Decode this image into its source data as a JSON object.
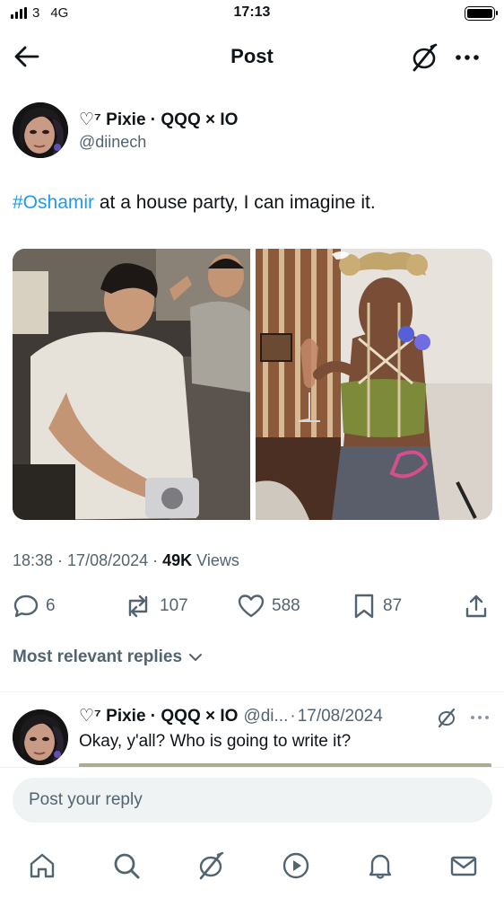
{
  "status_bar": {
    "carrier": "3",
    "network": "4G",
    "time": "17:13",
    "battery_level": 1.0
  },
  "header": {
    "title": "Post",
    "back_icon": "arrow-left-icon",
    "brand_icon": "circle-slash-logo-icon",
    "more_icon": "more-horizontal-icon"
  },
  "post": {
    "author": {
      "display_name": "♡⁷ Pixie · QQQ × IO",
      "handle": "@diinech"
    },
    "text": {
      "hashtag": "#Oshamir",
      "body": " at a house party, I can imagine it."
    },
    "meta": {
      "time": "18:38",
      "sep1": "·",
      "date": "17/08/2024",
      "sep2": "·",
      "views_count": "49K",
      "views_label": "Views"
    },
    "actions": {
      "replies": "6",
      "reposts": "107",
      "likes": "588",
      "bookmarks": "87"
    }
  },
  "replies_filter": {
    "label": "Most relevant replies"
  },
  "reply": {
    "display_name": "♡⁷ Pixie · QQQ × IO",
    "handle": "@di...",
    "sep": "·",
    "date": "17/08/2024",
    "text": "Okay, y'all? Who is going to write it?"
  },
  "composer": {
    "placeholder": "Post your reply"
  },
  "tabbar": {
    "items": [
      "home-icon",
      "search-icon",
      "circle-slash-logo-icon",
      "play-icon",
      "bell-icon",
      "mail-icon"
    ]
  },
  "colors": {
    "accent": "#1d9bf0",
    "secondary_text": "#536471",
    "primary_text": "#0f1419",
    "surface": "#eff3f4"
  }
}
